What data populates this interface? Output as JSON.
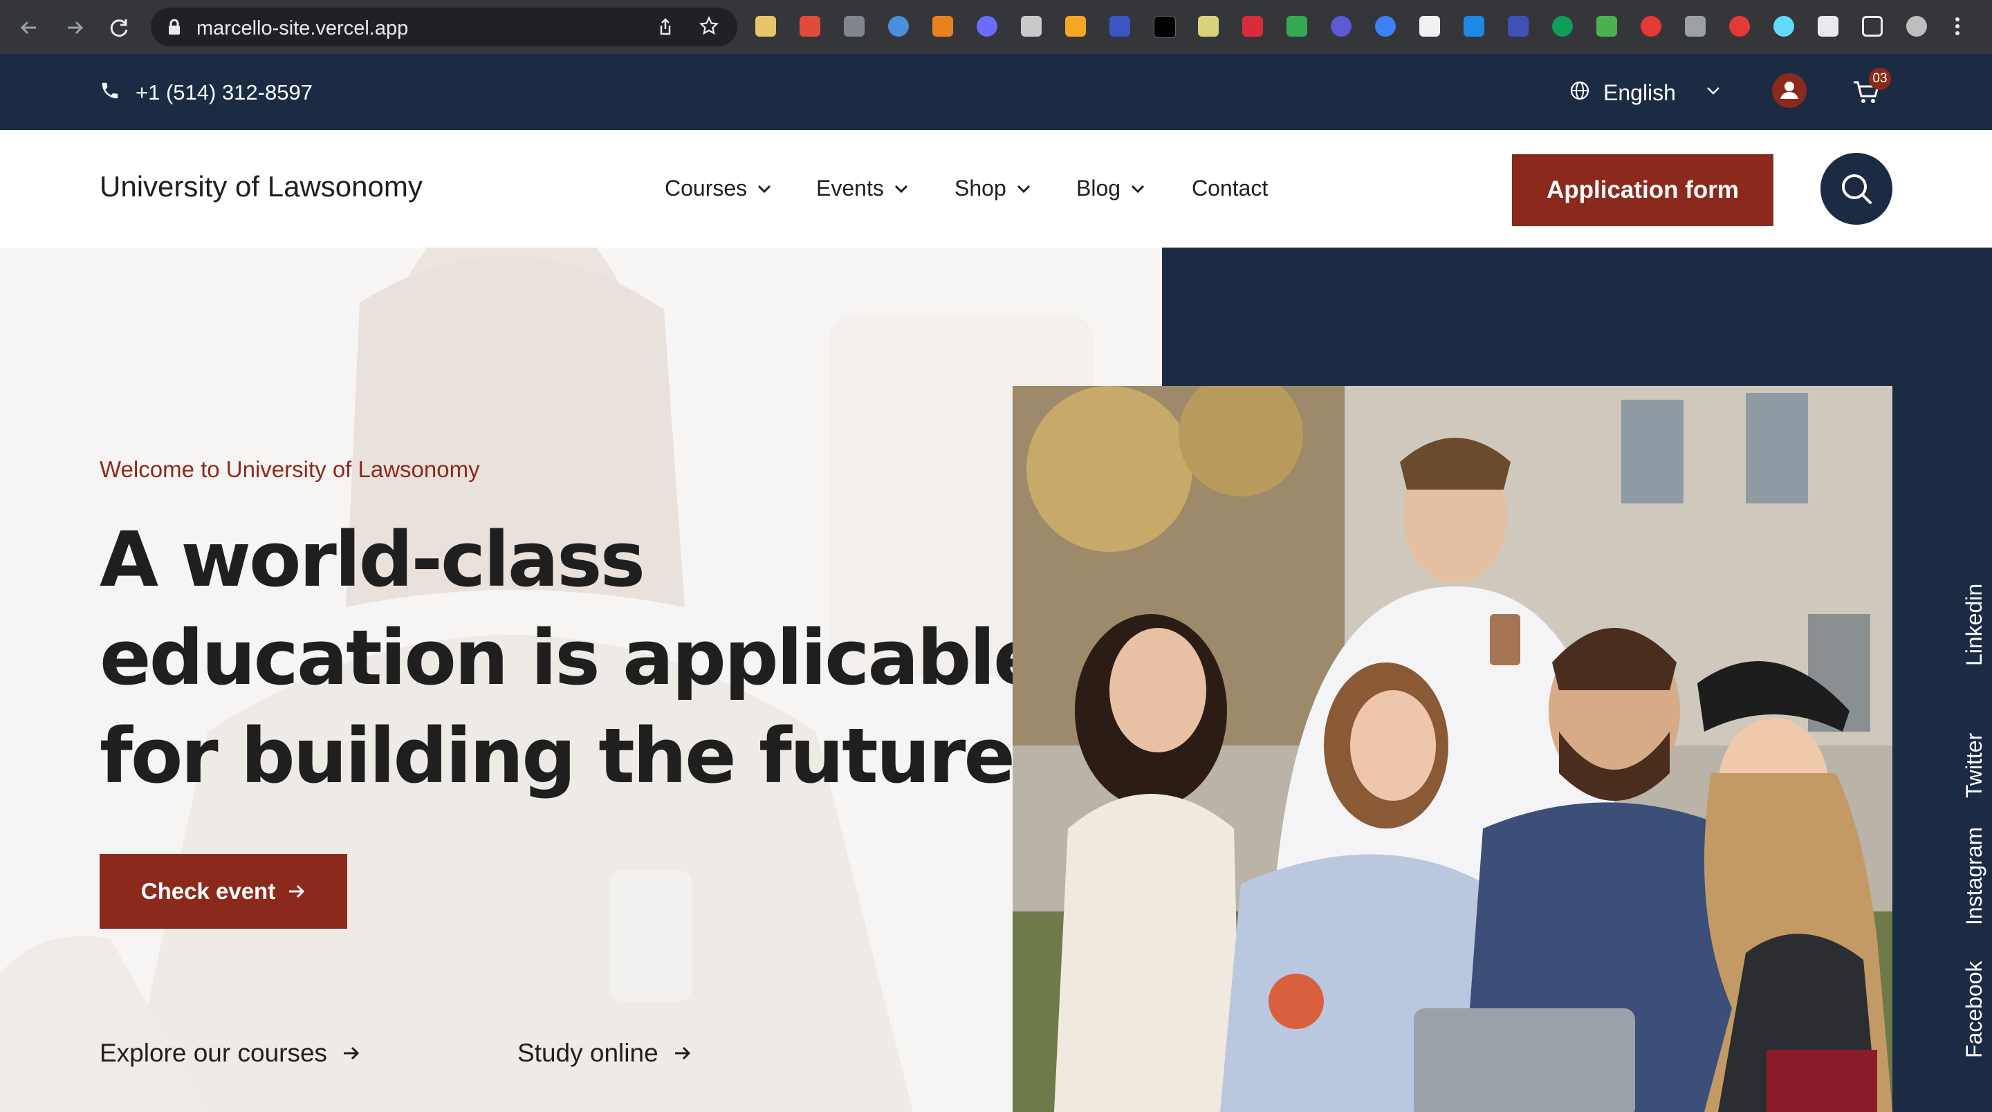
{
  "browser": {
    "url": "marcello-site.vercel.app"
  },
  "topbar": {
    "phone": "+1 (514) 312-8597",
    "language": "English",
    "cart_count": "03"
  },
  "header": {
    "logo": "University of Lawsonomy",
    "nav": [
      {
        "label": "Courses"
      },
      {
        "label": "Events"
      },
      {
        "label": "Shop"
      },
      {
        "label": "Blog"
      },
      {
        "label": "Contact"
      }
    ],
    "application_button": "Application form"
  },
  "hero": {
    "eyebrow": "Welcome to University of Lawsonomy",
    "headline_lines": [
      "A world-class",
      "education is applicable",
      "for building the future"
    ],
    "cta": "Check event",
    "links": [
      "Explore our courses",
      "Study online"
    ]
  },
  "social": [
    "Linkedin",
    "Twitter",
    "Instagram",
    "Facebook"
  ],
  "colors": {
    "accent": "#8b2a1c",
    "navy": "#1c2b44"
  }
}
